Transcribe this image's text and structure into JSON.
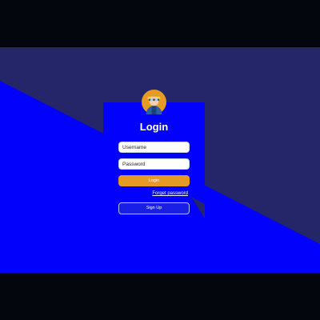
{
  "login_form": {
    "title": "Login",
    "username_placeholder": "Username",
    "password_placeholder": "Password",
    "login_label": "Login",
    "forgot_password_label": "Forget password",
    "signup_label": "Sign Up",
    "avatar_icon": "user-avatar-icon"
  },
  "colors": {
    "page_bar": "#03060d",
    "background_blue": "#0202fc",
    "background_navy": "#25256a",
    "accent_orange": "#e59a24",
    "text_white": "#ffffff"
  }
}
